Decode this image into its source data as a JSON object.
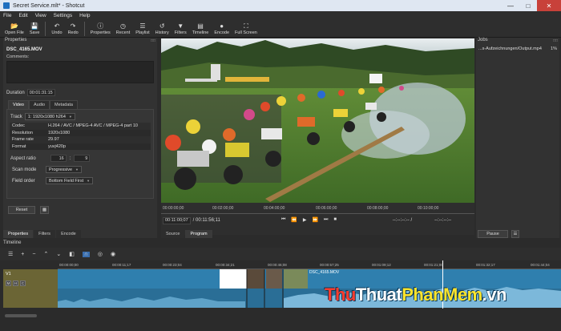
{
  "window": {
    "title": "Secret Service.mlt* - Shotcut"
  },
  "menu": [
    "File",
    "Edit",
    "View",
    "Settings",
    "Help"
  ],
  "toolbar": [
    {
      "label": "Open File",
      "icon": "open-file-icon"
    },
    {
      "label": "Save",
      "icon": "save-icon"
    },
    {
      "label": "Undo",
      "icon": "undo-icon"
    },
    {
      "label": "Redo",
      "icon": "redo-icon"
    },
    {
      "label": "Properties",
      "icon": "properties-icon"
    },
    {
      "label": "Recent",
      "icon": "recent-icon"
    },
    {
      "label": "Playlist",
      "icon": "playlist-icon"
    },
    {
      "label": "History",
      "icon": "history-icon"
    },
    {
      "label": "Filters",
      "icon": "filters-icon"
    },
    {
      "label": "Timeline",
      "icon": "timeline-icon"
    },
    {
      "label": "Encode",
      "icon": "encode-icon"
    },
    {
      "label": "Full Screen",
      "icon": "fullscreen-icon"
    }
  ],
  "properties": {
    "title": "Properties",
    "clip_name": "DSC_4165.MOV",
    "comments_label": "Comments:",
    "duration_label": "Duration",
    "duration_value": "00:01:31:15",
    "tabs": [
      "Video",
      "Audio",
      "Metadata"
    ],
    "track_label": "Track",
    "track_value": "1: 1920x1080 h264",
    "rows": [
      {
        "k": "Codec",
        "v": "H.264 / AVC / MPEG-4 AVC / MPEG-4 part 10"
      },
      {
        "k": "Resolution",
        "v": "1920x1080"
      },
      {
        "k": "Frame rate",
        "v": "29.97"
      },
      {
        "k": "Format",
        "v": "yuvj420p"
      }
    ],
    "aspect_label": "Aspect ratio",
    "aspect_w": "16",
    "aspect_h": "9",
    "scan_label": "Scan mode",
    "scan_value": "Progressive",
    "field_label": "Field order",
    "field_value": "Bottom Field First",
    "reset_label": "Reset"
  },
  "left_tabs": [
    "Properties",
    "Filters",
    "Encode"
  ],
  "player": {
    "ruler": [
      "00:00:00;00",
      "00:02:00;00",
      "00:04:00;00",
      "00:06:00;00",
      "00:08:00;00",
      "00:10:00;00"
    ],
    "current": "00:11:00;07",
    "total": "/ 00:11:56;11",
    "in_point": "--:--:--:-- /",
    "out_point": "--:--:--:--",
    "tabs": [
      "Source",
      "Program"
    ]
  },
  "jobs": {
    "title": "Jobs",
    "items": [
      {
        "name": "...s-Aufzeichnungen/Output.mp4",
        "progress": "1%"
      }
    ],
    "pause_label": "Pause"
  },
  "timeline": {
    "title": "Timeline",
    "ruler": [
      "00:00:00;00",
      "00:00:11;17",
      "00:00:23;04",
      "00:00:34;21",
      "00:00:46;08",
      "00:00:57;25",
      "00:01:09;12",
      "00:01:21;00",
      "00:01:32;17",
      "00:01:44;04"
    ],
    "track_name": "V1",
    "track_btns": [
      "M",
      "H",
      "C"
    ],
    "clip_label": "DSC_4165.MOV"
  },
  "watermark": {
    "part1": "Thu",
    "part2": "Thuat",
    "part3": "PhanMem",
    "part4": ".vn"
  }
}
